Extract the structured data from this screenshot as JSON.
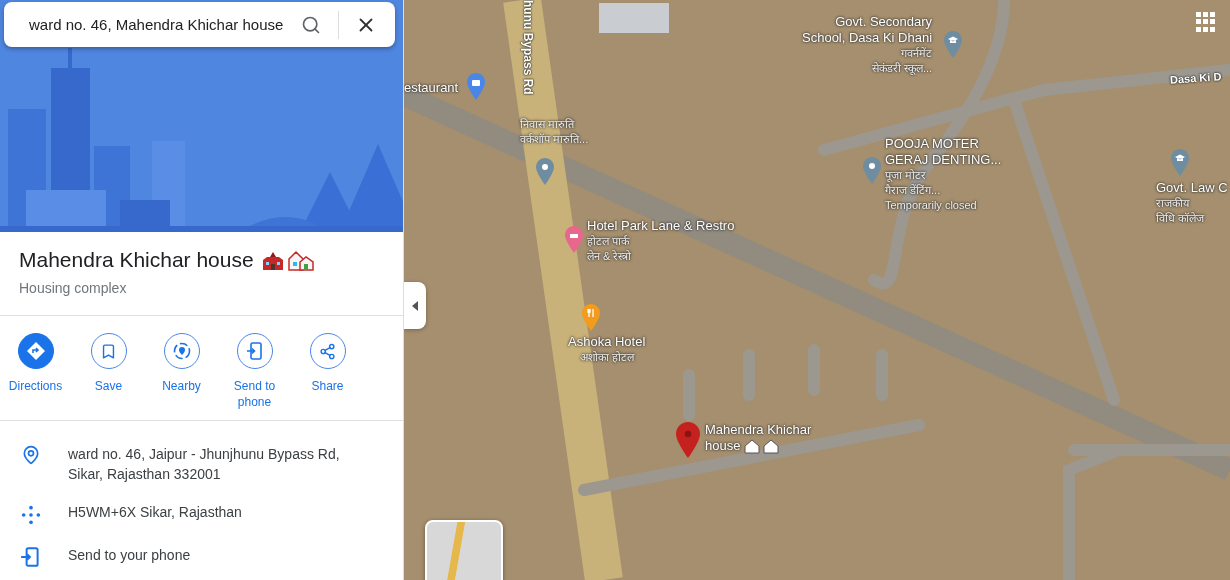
{
  "search": {
    "value": "ward no. 46, Mahendra Khichar house"
  },
  "place": {
    "name": "Mahendra Khichar house",
    "category": "Housing complex"
  },
  "actions": [
    {
      "kind": "directions",
      "label": "Directions",
      "filled": true
    },
    {
      "kind": "save",
      "label": "Save",
      "filled": false
    },
    {
      "kind": "nearby",
      "label": "Nearby",
      "filled": false
    },
    {
      "kind": "send",
      "label": "Send to phone",
      "filled": false
    },
    {
      "kind": "share",
      "label": "Share",
      "filled": false
    }
  ],
  "details": [
    {
      "kind": "address",
      "lines": [
        "ward no. 46, Jaipur - Jhunjhunu Bypass Rd, Sikar, Rajasthan 332001"
      ]
    },
    {
      "kind": "pluscode",
      "lines": [
        "H5WM+6X Sikar, Rajasthan"
      ]
    },
    {
      "kind": "phone",
      "lines": [
        "Send to your phone"
      ]
    }
  ],
  "map": {
    "labels": [
      {
        "kind": "shopping",
        "color": "#4a86e8",
        "title": [
          "estaurant"
        ]
      },
      {
        "kind": "road",
        "title": [
          "hunu Bypass Rd"
        ]
      },
      {
        "kind": "generic",
        "color": "#6f8da0",
        "subtitle": [
          "निवास मारुति",
          "वर्कशॉप मारुति..."
        ]
      },
      {
        "kind": "hotel",
        "color": "#e8678d",
        "title": [
          "Hotel Park Lane & Restro"
        ],
        "subtitle": [
          "होटल पार्क",
          "लेन & रेस्त्रो"
        ]
      },
      {
        "kind": "restaurant",
        "color": "#f29b1d",
        "title": [
          "Ashoka Hotel"
        ],
        "subtitle": [
          "अशोका होटल"
        ]
      },
      {
        "kind": "selected",
        "color": "#c5221f",
        "title": [
          "Mahendra Khichar",
          "house"
        ]
      },
      {
        "kind": "school",
        "color": "#6f8da0",
        "title": [
          "Govt. Secondary",
          "School, Dasa Ki Dhani"
        ],
        "subtitle": [
          "गवर्नमेंट",
          "सेकंडरी स्कूल..."
        ]
      },
      {
        "kind": "generic",
        "color": "#6f8da0",
        "title": [
          "POOJA MOTER",
          "GERAJ DENTING..."
        ],
        "subtitle": [
          "पूजा मोटर",
          "गैराज डेंटिंग...",
          "Temporarily closed"
        ]
      },
      {
        "kind": "road",
        "title": [
          "Dasa Ki D"
        ]
      },
      {
        "kind": "school",
        "color": "#6f8da0",
        "title": [
          "Govt. Law C"
        ],
        "subtitle": [
          "राजकीय",
          "विधि कॉलेज"
        ]
      }
    ]
  }
}
